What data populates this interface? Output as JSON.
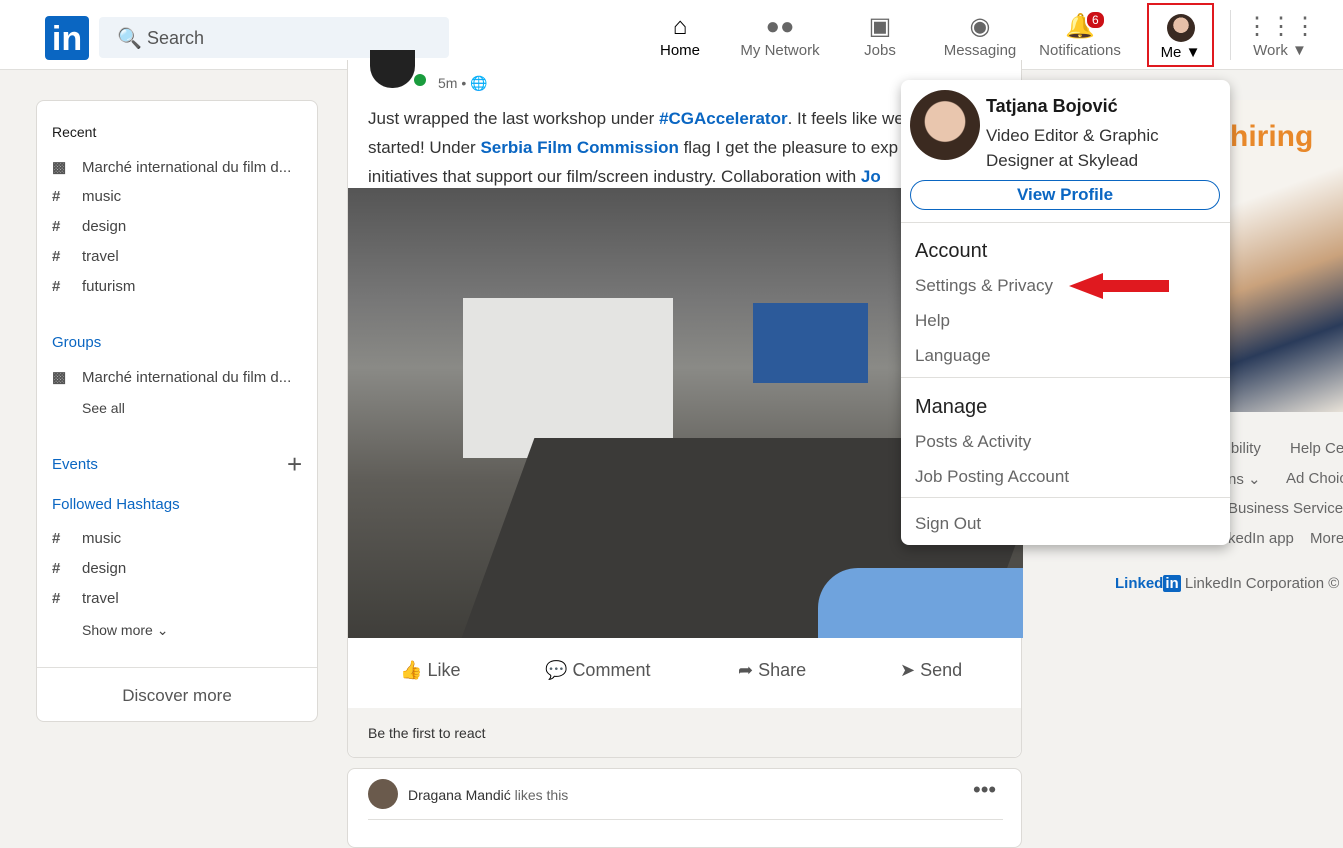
{
  "header": {
    "logo": "in",
    "search_placeholder": "Search",
    "nav": [
      {
        "label": "Home",
        "icon": "home-icon"
      },
      {
        "label": "My Network",
        "icon": "network-icon"
      },
      {
        "label": "Jobs",
        "icon": "briefcase-icon"
      },
      {
        "label": "Messaging",
        "icon": "chat-icon"
      },
      {
        "label": "Notifications",
        "icon": "bell-icon",
        "badge": "6"
      },
      {
        "label": "Me",
        "icon": "avatar"
      },
      {
        "label": "Work",
        "icon": "grid-icon"
      }
    ]
  },
  "sidebar": {
    "recent_title": "Recent",
    "recent": [
      "Marché international du film d...",
      "music",
      "design",
      "travel",
      "futurism"
    ],
    "groups_title": "Groups",
    "groups": [
      "Marché international du film d..."
    ],
    "see_all": "See all",
    "events_title": "Events",
    "hashtags_title": "Followed Hashtags",
    "hashtags": [
      "music",
      "design",
      "travel"
    ],
    "show_more": "Show more",
    "discover": "Discover more"
  },
  "post": {
    "time": "5m •",
    "line1": "Just wrapped the last workshop under ",
    "tag": "#CGAccelerator",
    "line1b": ". It feels like we",
    "line2a": "started! Under ",
    "org": "Serbia Film Commission",
    "line2b": " flag I get the pleasure to exp",
    "line3a": "initiatives that support our film/screen industry. Collaboration with ",
    "line3b": "Jo",
    "actions": [
      "Like",
      "Comment",
      "Share",
      "Send"
    ],
    "reactions": "Be the first to react"
  },
  "next_post": {
    "name": "Dragana Mandić",
    "suffix": " likes this"
  },
  "dropdown": {
    "name": "Tatjana Bojović",
    "headline1": "Video Editor & Graphic",
    "headline2": "Designer at Skylead",
    "view_profile": "View Profile",
    "account_title": "Account",
    "account": [
      "Settings & Privacy",
      "Help",
      "Language"
    ],
    "manage_title": "Manage",
    "manage": [
      "Posts & Activity",
      "Job Posting Account"
    ],
    "sign_out": "Sign Out"
  },
  "right": {
    "ad_text": "hiring",
    "links": [
      "sibility",
      "Help Ce",
      "ns",
      "Ad Choic",
      "Business Services",
      "kedIn app",
      "More"
    ],
    "brand": "Linked",
    "brand_in": "in",
    "corp": "LinkedIn Corporation ©"
  },
  "colors": {
    "brand": "#0a66c2",
    "highlight": "#e0191f",
    "arrow": "#e0191f"
  }
}
